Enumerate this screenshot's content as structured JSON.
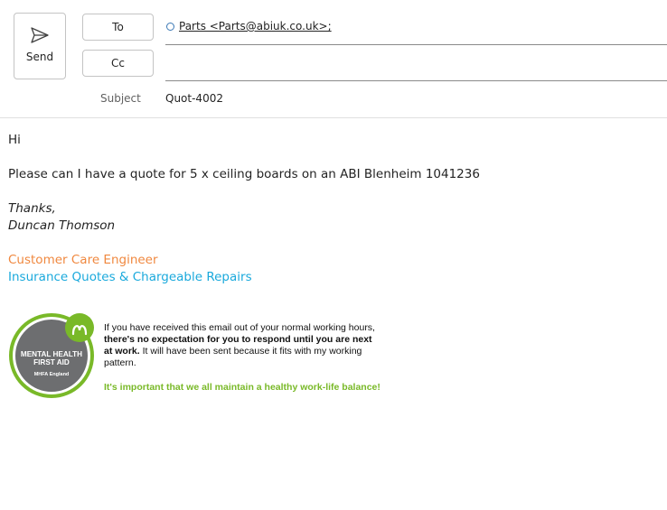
{
  "toolbar": {
    "send_label": "Send",
    "to_label": "To",
    "cc_label": "Cc"
  },
  "recipients": {
    "to": "Parts <Parts@abiuk.co.uk>;",
    "cc": ""
  },
  "subject": {
    "label": "Subject",
    "value": "Quot-4002"
  },
  "message": {
    "greeting": "Hi",
    "request": "Please can I have a quote for 5 x ceiling boards on an ABI Blenheim 1041236",
    "sign_off": "Thanks,",
    "sender_name": "Duncan Thomson",
    "role": "Customer Care Engineer",
    "department": "Insurance Quotes & Chargeable Repairs"
  },
  "mhfa_badge": {
    "line1": "MENTAL HEALTH",
    "line2": "FIRST AID",
    "line3": "MHFA England",
    "colors": {
      "ring": "#79b928",
      "disc": "#6d6e70"
    }
  },
  "notice": {
    "part1": "If you have received this email out of your normal working hours, ",
    "bold": "there's no expectation for you to respond until you are next at work.",
    "part2": " It will have been sent because it fits with my working pattern.",
    "balance": "It's important that we all maintain a healthy work-life balance!"
  },
  "colors": {
    "role": "#f0883f",
    "department": "#1aa9dc",
    "balance": "#79b928"
  }
}
